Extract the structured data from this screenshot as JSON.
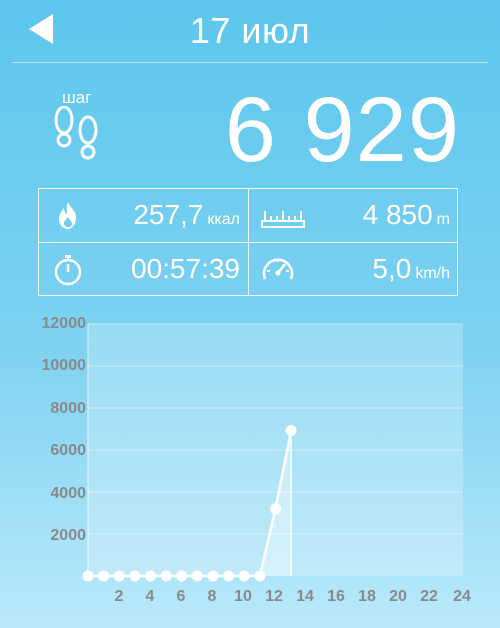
{
  "header": {
    "title": "17 июл",
    "back_icon": "back-arrow-icon"
  },
  "steps": {
    "label": "шаг",
    "value": "6 929",
    "icon": "footprints-icon"
  },
  "stats": [
    {
      "icon": "calories-flame-icon",
      "value": "257,7",
      "unit": "ккал"
    },
    {
      "icon": "distance-ruler-icon",
      "value": "4 850",
      "unit": "m"
    },
    {
      "icon": "stopwatch-icon",
      "value": "00:57:39",
      "unit": ""
    },
    {
      "icon": "speedometer-icon",
      "value": "5,0",
      "unit": "km/h"
    }
  ],
  "chart_data": {
    "type": "line",
    "y_ticks": [
      "12000",
      "10000",
      "8000",
      "6000",
      "4000",
      "2000"
    ],
    "x_ticks": [
      "2",
      "4",
      "6",
      "8",
      "10",
      "12",
      "14",
      "16",
      "18",
      "20",
      "22",
      "24"
    ],
    "ylim": [
      0,
      12000
    ],
    "xlim": [
      0,
      24
    ],
    "grid": true,
    "series": [
      {
        "x": [
          0,
          1,
          2,
          3,
          4,
          5,
          6,
          7,
          8,
          9,
          10,
          11,
          12,
          13
        ],
        "values": [
          0,
          0,
          0,
          0,
          0,
          0,
          0,
          0,
          0,
          0,
          0,
          0,
          3200,
          6929
        ]
      }
    ]
  }
}
